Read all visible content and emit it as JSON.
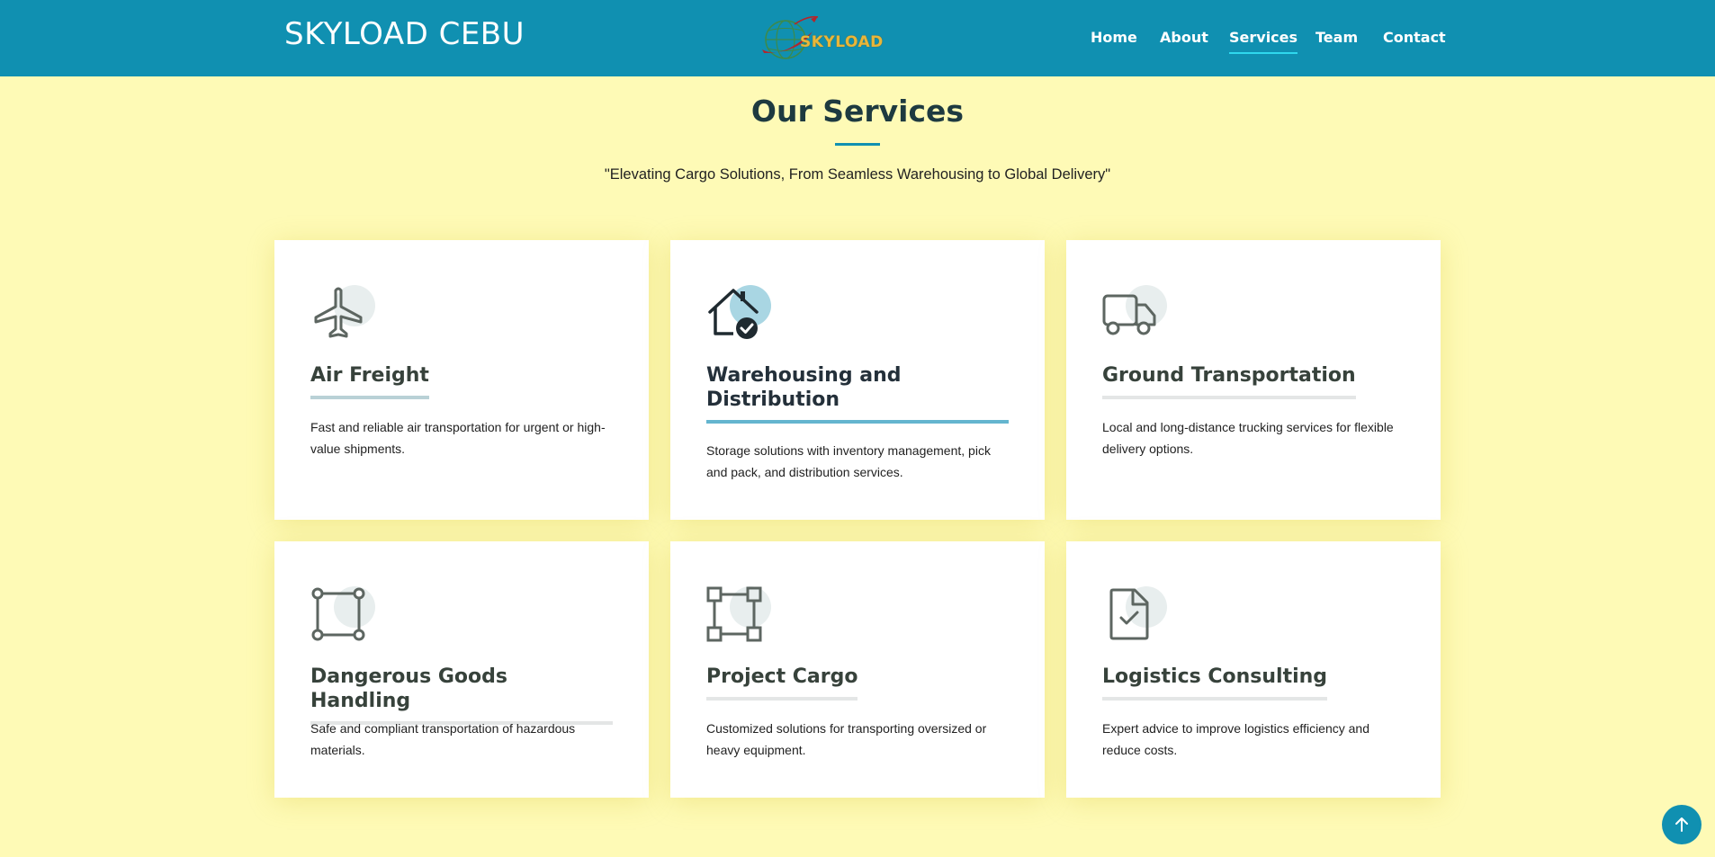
{
  "header": {
    "brand": "SKYLOAD CEBU",
    "logo_text": "SKYLOAD",
    "nav": [
      {
        "label": "Home"
      },
      {
        "label": "About"
      },
      {
        "label": "Services"
      },
      {
        "label": "Team"
      },
      {
        "label": "Contact"
      }
    ],
    "active_nav": "Services",
    "colors": {
      "header_bg": "#1090b1",
      "page_bg": "#fefab6",
      "accent": "#1090b1"
    }
  },
  "section": {
    "title": "Our Services",
    "subtitle": "\"Elevating Cargo Solutions, From Seamless Warehousing to Global Delivery\""
  },
  "services": [
    {
      "title": "Air Freight",
      "description": "Fast and reliable air transportation for urgent or high-value shipments.",
      "icon": "airplane-icon"
    },
    {
      "title": "Warehousing and Distribution",
      "description": "Storage solutions with inventory management, pick and pack, and distribution services.",
      "icon": "house-check-icon"
    },
    {
      "title": "Ground Transportation",
      "description": "Local and long-distance trucking services for flexible delivery options.",
      "icon": "truck-icon"
    },
    {
      "title": "Dangerous Goods Handling",
      "description": "Safe and compliant transportation of hazardous materials.",
      "icon": "bounding-box-icon"
    },
    {
      "title": "Project Cargo",
      "description": "Customized solutions for transporting oversized or heavy equipment.",
      "icon": "vector-square-icon"
    },
    {
      "title": "Logistics Consulting",
      "description": "Expert advice to improve logistics efficiency and reduce costs.",
      "icon": "file-check-icon"
    }
  ],
  "back_to_top": {
    "icon": "arrow-up-icon"
  }
}
